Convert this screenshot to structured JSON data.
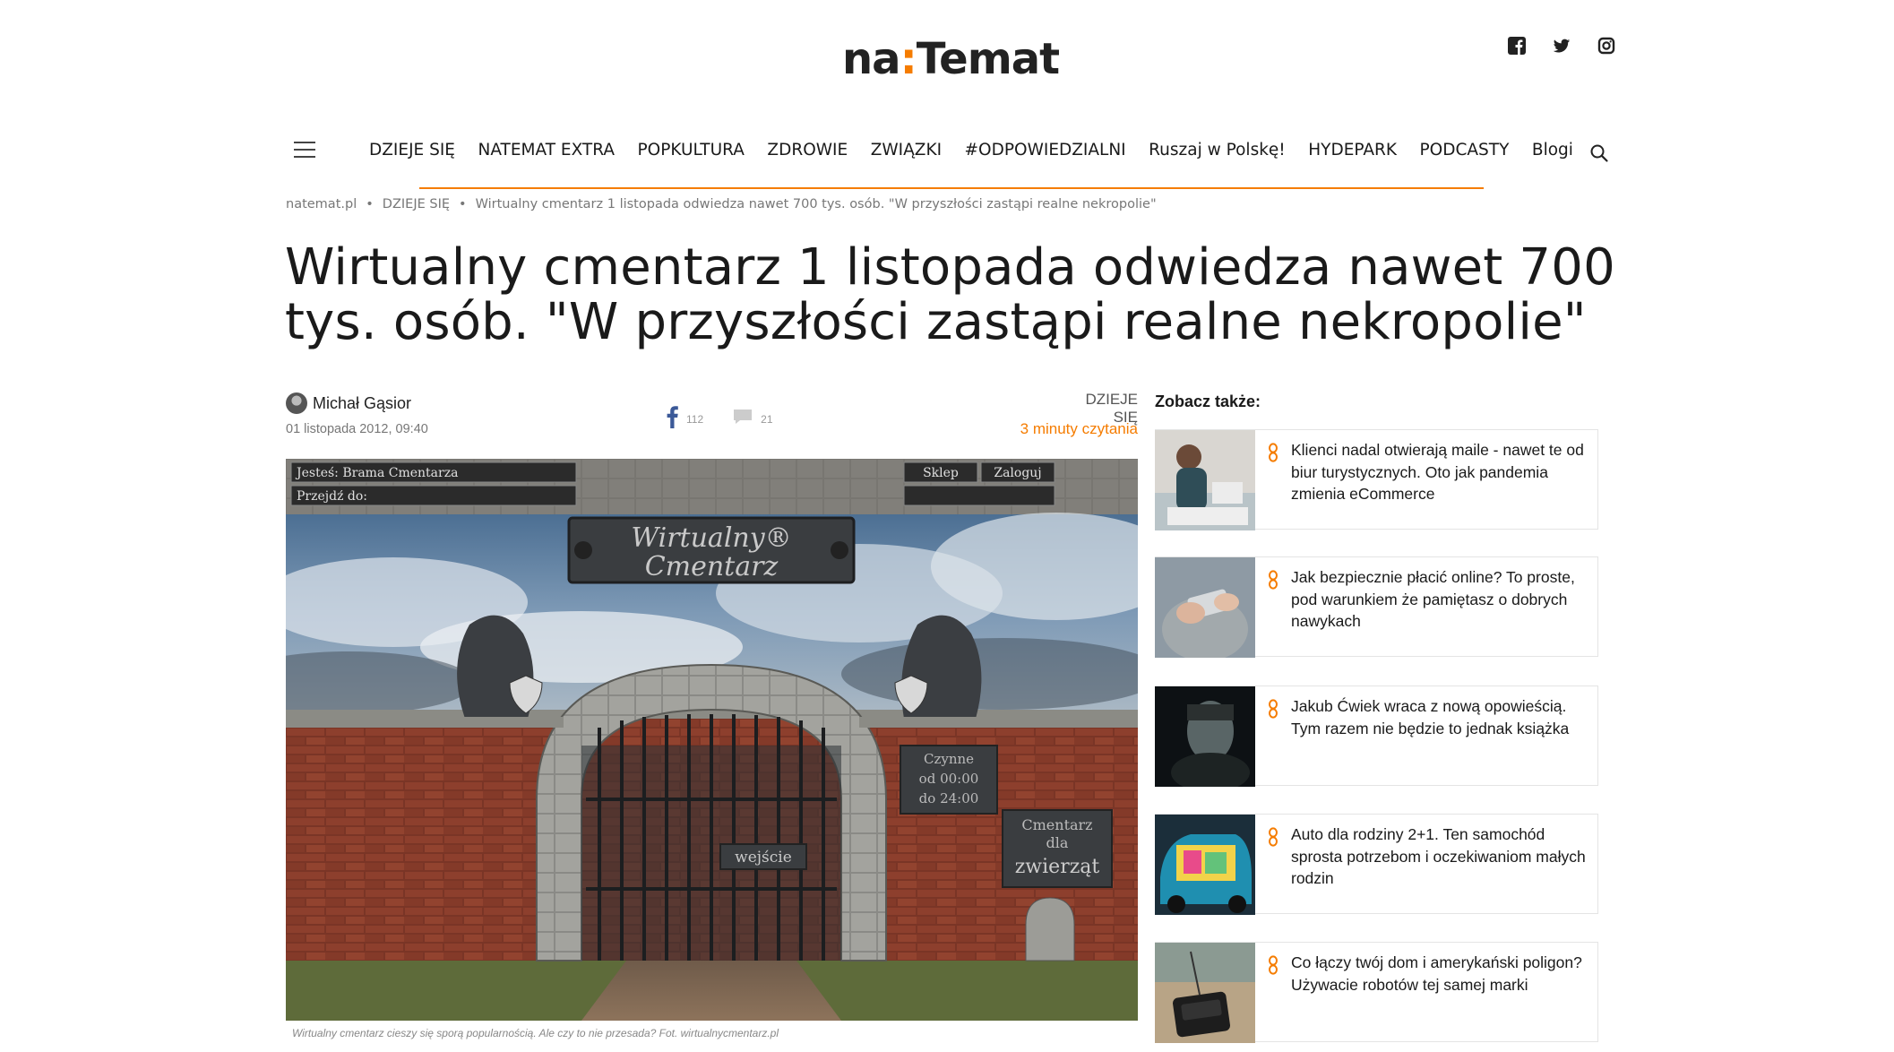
{
  "header": {
    "logo_left": "na",
    "logo_colon": ":",
    "logo_right": "Temat",
    "social": [
      "facebook-icon",
      "twitter-icon",
      "instagram-icon"
    ]
  },
  "nav": {
    "items": [
      "DZIEJE SIĘ",
      "NATEMAT EXTRA",
      "POPKULTURA",
      "ZDROWIE",
      "ZWIĄZKI",
      "#ODPOWIEDZIALNI",
      "Ruszaj w Polskę!",
      "HYDEPARK",
      "PODCASTY",
      "Blogi"
    ]
  },
  "breadcrumb": {
    "home": "natemat.pl",
    "section": "DZIEJE SIĘ",
    "current": "Wirtualny cmentarz 1 listopada odwiedza nawet 700 tys. osób. \"W przyszłości zastąpi realne nekropolie\""
  },
  "article": {
    "title": "Wirtualny cmentarz 1 listopada odwiedza nawet 700 tys. osób. \"W przyszłości zastąpi realne nekropolie\"",
    "author": "Michał Gąsior",
    "date": "01 listopada 2012, 09:40",
    "fb_count": "112",
    "comment_count": "21",
    "category": "DZIEJE SIĘ",
    "read_time": "3 minuty czytania",
    "caption": "Wirtualny cmentarz cieszy się sporą popularnością. Ale czy to nie przesada? Fot. wirtualnycmentarz.pl"
  },
  "hero_image": {
    "location_label": "Jesteś: Brama Cmentarza",
    "goto_label": "Przejdź do:",
    "shop": "Sklep",
    "login": "Zaloguj",
    "sign_line1": "Wirtualny®",
    "sign_line2": "Cmentarz",
    "hours_title": "Czynne",
    "hours_from": "od 00:00",
    "hours_to": "do 24:00",
    "pets_line1": "Cmentarz",
    "pets_line2": "dla",
    "pets_line3": "zwierząt",
    "entrance": "wejście"
  },
  "sidebar": {
    "heading": "Zobacz także:",
    "items": [
      {
        "title": "Klienci nadal otwierają maile - nawet te od biur turystycznych. Oto jak pandemia zmienia eCommerce"
      },
      {
        "title": "Jak bezpiecznie płacić online? To proste, pod warunkiem że pamiętasz o dobrych nawykach"
      },
      {
        "title": "Jakub Ćwiek wraca z nową opowieścią. Tym razem nie będzie to jednak książka"
      },
      {
        "title": "Auto dla rodziny 2+1. Ten samochód sprosta potrzebom i oczekiwaniom małych rodzin"
      },
      {
        "title": "Co łączy twój dom i amerykański poligon? Używacie robotów tej samej marki"
      }
    ]
  },
  "colors": {
    "accent": "#f57c00",
    "text": "#1a1a1a",
    "muted": "#777777"
  }
}
